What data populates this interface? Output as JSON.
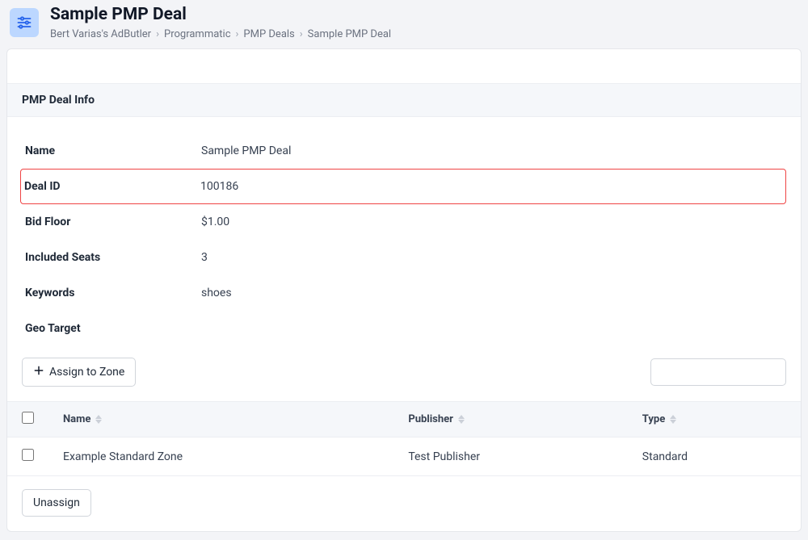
{
  "header": {
    "title": "Sample PMP Deal",
    "breadcrumb": [
      "Bert Varias's AdButler",
      "Programmatic",
      "PMP Deals",
      "Sample PMP Deal"
    ]
  },
  "sectionTitle": "PMP Deal Info",
  "info": {
    "nameLabel": "Name",
    "nameValue": "Sample PMP Deal",
    "dealIdLabel": "Deal ID",
    "dealIdValue": "100186",
    "bidFloorLabel": "Bid Floor",
    "bidFloorValue": "$1.00",
    "includedSeatsLabel": "Included Seats",
    "includedSeatsValue": "3",
    "keywordsLabel": "Keywords",
    "keywordsValue": "shoes",
    "geoTargetLabel": "Geo Target",
    "geoTargetValue": ""
  },
  "buttons": {
    "assign": "Assign to Zone",
    "unassign": "Unassign"
  },
  "table": {
    "headers": {
      "name": "Name",
      "publisher": "Publisher",
      "type": "Type"
    },
    "rows": [
      {
        "name": "Example Standard Zone",
        "publisher": "Test Publisher",
        "type": "Standard"
      }
    ]
  }
}
